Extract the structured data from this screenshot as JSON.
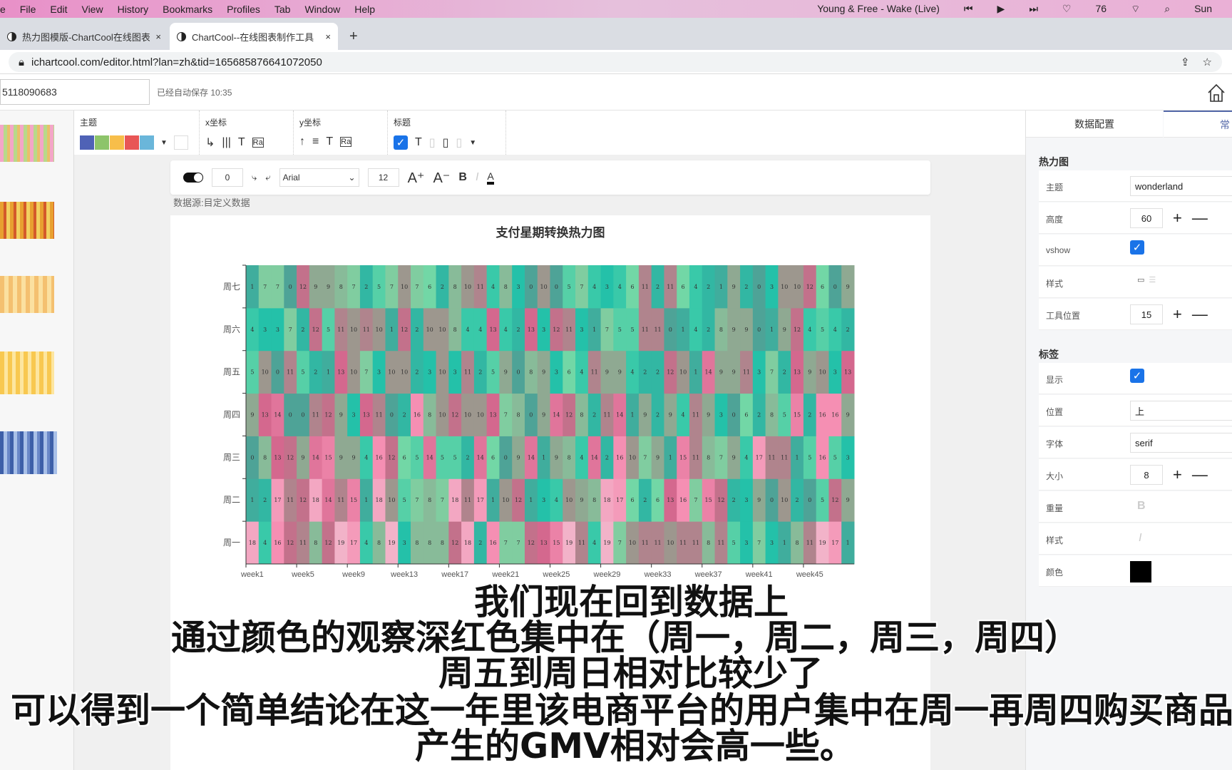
{
  "menubar": {
    "items": [
      "e",
      "File",
      "Edit",
      "View",
      "History",
      "Bookmarks",
      "Profiles",
      "Tab",
      "Window",
      "Help"
    ],
    "now_playing": "Young & Free - Wake (Live)",
    "battery": "76",
    "clock": "Sun"
  },
  "browser": {
    "tabs": [
      {
        "label": "热力图模版-ChartCool在线图表"
      },
      {
        "label": "ChartCool--在线图表制作工具"
      }
    ],
    "url": "ichartcool.com/editor.html?lan=zh&tid=165685876641072050"
  },
  "app": {
    "doc_id": "5118090683",
    "saved": "已经自动保存 10:35"
  },
  "toolbar": {
    "theme_label": "主题",
    "x_label": "x坐标",
    "y_label": "y坐标",
    "title_label": "标题",
    "theme_colors": [
      "#4f62b6",
      "#8dc46a",
      "#f7be4a",
      "#e85656",
      "#6ab6da"
    ]
  },
  "fontbar": {
    "rotation": "0",
    "font": "Arial",
    "size": "12"
  },
  "data_source": "数据源:目定义数据",
  "chart_data": {
    "type": "heatmap",
    "title": "支付星期转换热力图",
    "x_ticks": [
      "week1",
      "week5",
      "week9",
      "week13",
      "week17",
      "week21",
      "week25",
      "week29",
      "week33",
      "week37",
      "week41",
      "week45"
    ],
    "y_categories": [
      "周一",
      "周二",
      "周三",
      "周四",
      "周五",
      "周六",
      "周七"
    ],
    "x_count": 48,
    "visual_colors": [
      "#4ea397",
      "#22c3aa",
      "#7bd9a5",
      "#93a08f",
      "#d0648a",
      "#f58db2",
      "#f2b3c9"
    ],
    "value_range": [
      0,
      19
    ],
    "values": {
      "周七": [
        1,
        7,
        7,
        0,
        12,
        9,
        9,
        8,
        7,
        2,
        5,
        7,
        10,
        7,
        6,
        2,
        8,
        10,
        11,
        4,
        8,
        3,
        0,
        10,
        0,
        5,
        7,
        4,
        3,
        4,
        6,
        11,
        2,
        11,
        6,
        4,
        2,
        1,
        9,
        2,
        0,
        3,
        10,
        10,
        12,
        6,
        0,
        9
      ],
      "周六": [
        4,
        3,
        3,
        7,
        2,
        12,
        5,
        11,
        10,
        11,
        10,
        1,
        12,
        2,
        10,
        10,
        8,
        4,
        4,
        13,
        4,
        2,
        13,
        3,
        12,
        11,
        3,
        1,
        7,
        5,
        5,
        11,
        11,
        0,
        1,
        4,
        2,
        8,
        9,
        9,
        0,
        1,
        9,
        12,
        4,
        5,
        4,
        2
      ],
      "周五": [
        5,
        10,
        0,
        11,
        5,
        2,
        1,
        13,
        10,
        7,
        3,
        10,
        10,
        2,
        3,
        10,
        3,
        11,
        2,
        5,
        9,
        0,
        8,
        9,
        3,
        6,
        4,
        11,
        9,
        9,
        4,
        2,
        2,
        12,
        10,
        1,
        14,
        9,
        9,
        11,
        3,
        7,
        2,
        13,
        9,
        10,
        3,
        13
      ],
      "周四": [
        9,
        13,
        14,
        0,
        0,
        11,
        12,
        9,
        3,
        13,
        11,
        0,
        2,
        16,
        8,
        10,
        12,
        10,
        10,
        13,
        7,
        8,
        0,
        9,
        14,
        12,
        8,
        2,
        11,
        14,
        1,
        9,
        2,
        9,
        4,
        11,
        9,
        3,
        0,
        6,
        2,
        8,
        5,
        15,
        2,
        16,
        16,
        9
      ],
      "周三": [
        0,
        8,
        13,
        12,
        9,
        14,
        15,
        9,
        9,
        4,
        16,
        12,
        6,
        5,
        14,
        5,
        5,
        2,
        14,
        6,
        0,
        9,
        14,
        1,
        9,
        8,
        4,
        14,
        2,
        16,
        10,
        7,
        9,
        1,
        15,
        11,
        8,
        7,
        9,
        4,
        17,
        11,
        11,
        1,
        5,
        16,
        5,
        3
      ],
      "周二": [
        1,
        2,
        17,
        11,
        12,
        18,
        14,
        11,
        15,
        1,
        18,
        10,
        5,
        7,
        8,
        7,
        18,
        11,
        17,
        1,
        10,
        12,
        1,
        3,
        4,
        10,
        9,
        8,
        18,
        17,
        6,
        2,
        6,
        13,
        16,
        7,
        15,
        12,
        2,
        3,
        9,
        0,
        10,
        2,
        0,
        5,
        12,
        9
      ],
      "周一": [
        18,
        4,
        16,
        12,
        11,
        8,
        12,
        19,
        17,
        4,
        8,
        19,
        3,
        8,
        8,
        8,
        12,
        18,
        2,
        16,
        7,
        7,
        12,
        13,
        15,
        19,
        11,
        4,
        19,
        7,
        10,
        11,
        11,
        10,
        11,
        11,
        8,
        11,
        5,
        3,
        7,
        3,
        1,
        8,
        11,
        19,
        17,
        1
      ]
    }
  },
  "panel": {
    "tabs": [
      "数据配置",
      "常"
    ],
    "heatmap_section": "热力图",
    "label_section": "标签",
    "heatmap_rows": {
      "theme_label": "主题",
      "theme": "wonderland",
      "height_label": "高度",
      "height": "60",
      "vshow_label": "vshow",
      "style_label": "样式",
      "toolpos_label": "工具位置",
      "toolpos": "15"
    },
    "label_rows": {
      "show_label": "显示",
      "pos_label": "位置",
      "pos": "上",
      "font_label": "字体",
      "font": "serif",
      "size_label": "大小",
      "size": "8",
      "weight_label": "重量",
      "style_label": "样式",
      "color_label": "颜色",
      "color": "#000000"
    }
  },
  "subtitles": [
    "我们现在回到数据上",
    "通过颜色的观察深红色集中在（周一，周二，周三，周四）",
    "周五到周日相对比较少了",
    "可以得到一个简单结论在这一年里该电商平台的用户集中在周一再周四购买商品",
    "产生的GMV相对会高一些。"
  ]
}
